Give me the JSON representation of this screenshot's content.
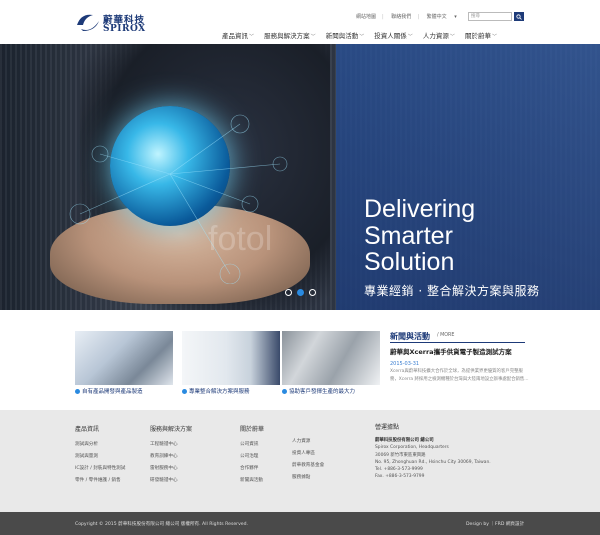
{
  "header": {
    "logo_cn": "蔚華科技",
    "logo_en": "SPIROX",
    "top_links": [
      "網站地圖",
      "聯絡我們",
      "繁體中文"
    ],
    "search_placeholder": "搜尋",
    "nav": [
      "產品資訊",
      "服務與解決方案",
      "新聞與活動",
      "投資人關係",
      "人力資源",
      "關於蔚華"
    ]
  },
  "hero": {
    "title_lines": [
      "Delivering",
      "Smarter",
      "Solution"
    ],
    "subtitle": "專業經銷 · 整合解決方案與服務",
    "watermark": "fotol",
    "slides": 3,
    "active_slide": 2
  },
  "cards": [
    {
      "caption": "自有產品開發與產品製造"
    },
    {
      "caption": "專業整合解決方案與服務"
    },
    {
      "caption": "協助客戶發揮生產的最大力"
    }
  ],
  "news": {
    "heading": "新聞與活動",
    "more": "/ MORE",
    "title": "蔚華與Xcerra攜手供貨電子製造測試方案",
    "date": "2015-03-31",
    "body": "Xcerra與蔚華科技擴大合作於全球，為提供業界更優質的客戶完整服務，Xcerra 將採用之檢測機種於台灣與大陸兩地設立辦事處配合銷售..."
  },
  "footer": {
    "columns": [
      {
        "heading": "產品資訊",
        "items": [
          "測試與分析",
          "測試與量測",
          "IC設計 / 封裝與特性測試",
          "零件 / 零件維護 / 銷售"
        ]
      },
      {
        "heading": "服務與解決方案",
        "items": [
          "工程驗證中心",
          "教育訓練中心",
          "雷射服務中心",
          "研發驗證中心"
        ]
      },
      {
        "heading": "關於蔚華",
        "items": [
          "公司資訊",
          "公司治理",
          "合作夥伴",
          "新聞與活動"
        ]
      },
      {
        "heading": "",
        "items": [
          "人力資源",
          "投資人專區",
          "蔚華教育基金會",
          "服務據點"
        ]
      }
    ],
    "contact": {
      "heading": "營運據點",
      "company": "蔚華科技股份有限公司 總公司",
      "company_en": "Spirox Corporation, Headquarters",
      "addr_cn": "30069 新竹市東區東興路",
      "addr_en": "No. 95, Zhonghuan Rd., Hsinchu City 30069, Taiwan.",
      "tel": "Tel. +886-3-573-9999",
      "fax": "Fax. +886-3-573-9799"
    },
    "copyright": "Copyright © 2015 蔚華科技股份有限公司 總公司 版權所有. All Rights Reserved.",
    "design": "Design by ｜FRD 網頁設計"
  }
}
